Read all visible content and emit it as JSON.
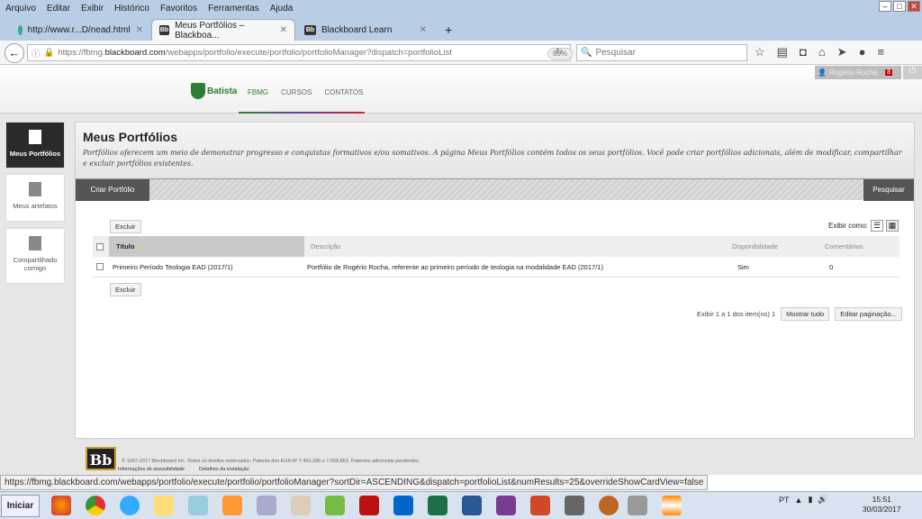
{
  "browser": {
    "menu": [
      "Arquivo",
      "Editar",
      "Exibir",
      "Histórico",
      "Favoritos",
      "Ferramentas",
      "Ajuda"
    ],
    "tabs": [
      {
        "title": "http://www.r...D/nead.html"
      },
      {
        "title": "Meus Portfólios – Blackboa...",
        "active": true
      },
      {
        "title": "Blackboard Learn"
      }
    ],
    "url_prefix": "https://fbmg.",
    "url_domain": "blackboard.com",
    "url_path": "/webapps/portfolio/execute/portfolio/portfolioManager?dispatch=portfolioList",
    "zoom": "80%",
    "search_placeholder": "Pesquisar",
    "status_url": "https://fbmg.blackboard.com/webapps/portfolio/execute/portfolio/portfolioManager?sortDir=ASCENDING&dispatch=portfolioList&numResults=25&overrideShowCardView=false"
  },
  "header": {
    "user": "Rogério Rocha",
    "notifications": "8",
    "logo_text": "Faculdade Batista de Minas Gerais",
    "nav": [
      "FBMG",
      "CURSOS",
      "CONTATOS"
    ]
  },
  "sidebar": {
    "items": [
      "Meus Portfólios",
      "Meus artefatos",
      "Compartilhado comigo"
    ]
  },
  "main": {
    "title": "Meus Portfólios",
    "description": "Portfólios oferecem um meio de demonstrar progresso e conquistas formativos e/ou somativos. A página Meus Portfólios contém todos os seus portfólios. Você pode criar portfólios adicionais, além de modificar, compartilhar e excluir portfólios existentes.",
    "create_label": "Criar Portfólio",
    "search_label": "Pesquisar",
    "delete_label": "Excluir",
    "view_as": "Exibir como:",
    "columns": [
      "Título",
      "Descrição",
      "Disponibilidade",
      "Comentários"
    ],
    "rows": [
      {
        "title": "Primeiro Período Teologia EAD (2017/1)",
        "description": "Portfólio de Rogério Rocha, referente ao primeiro período de teologia na modalidade EAD (2017/1)",
        "availability": "Sim",
        "comments": "0"
      }
    ],
    "pagination": {
      "text": "Exibir 1 a 1 dos item(ns) 1",
      "show_all": "Mostrar tudo",
      "edit": "Editar paginação..."
    }
  },
  "footer": {
    "copyright": "© 1997-2017 Blackboard Inc. Todos os direitos reservados. Patente dos EUA Nº 7.493.396 e 7.558.853. Patentes adicionais pendentes.",
    "links": [
      "Informações de acessibilidade",
      "Detalhes da instalação"
    ],
    "logo": "Bb"
  },
  "taskbar": {
    "start": "Iniciar",
    "lang": "PT",
    "time": "15:51",
    "date": "30/03/2017"
  }
}
